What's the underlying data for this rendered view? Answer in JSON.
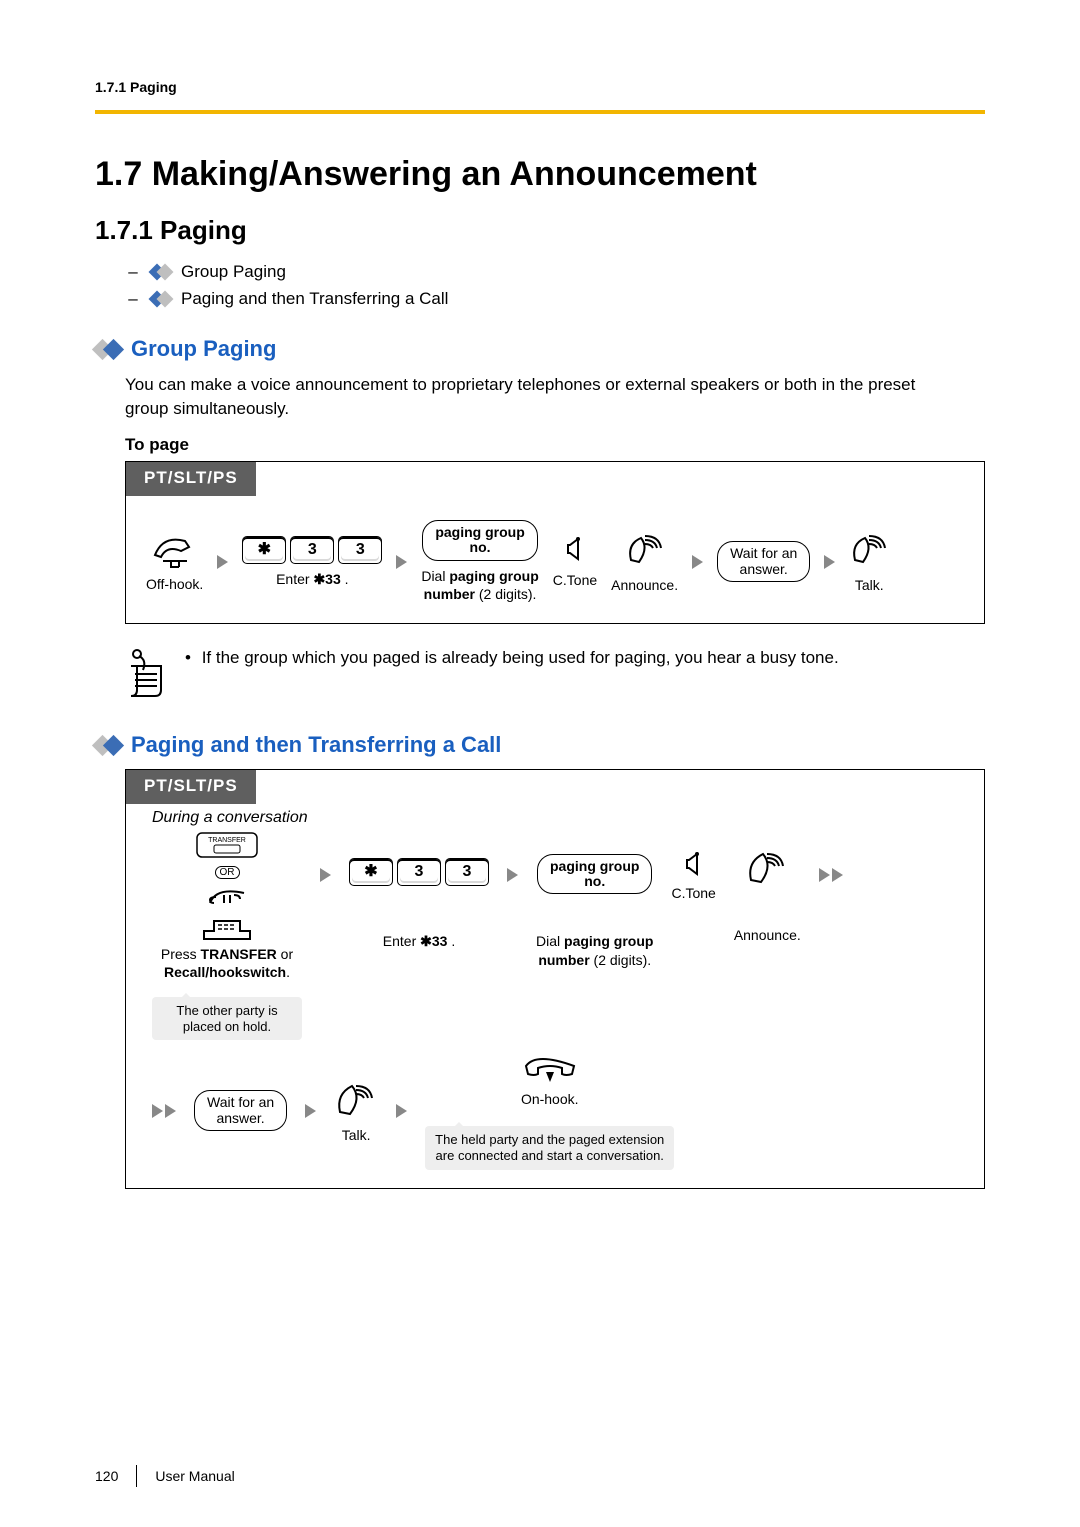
{
  "header": {
    "breadcrumb": "1.7.1 Paging"
  },
  "h1": "1.7  Making/Answering an Announcement",
  "h2": "1.7.1  Paging",
  "toc": {
    "item1": "Group Paging",
    "item2": "Paging and then Transferring a Call"
  },
  "group_paging": {
    "title": "Group Paging",
    "desc": "You can make a voice announcement to proprietary telephones or external speakers or both in the preset group simultaneously.",
    "to_page": "To page",
    "tab": "PT/SLT/PS",
    "steps": {
      "offhook": "Off-hook.",
      "star": "✱",
      "k3a": "3",
      "k3b": "3",
      "enter33_pre": "Enter ",
      "enter33_code": "✱33",
      "enter33_post": ".",
      "pg_box_l1": "paging group",
      "pg_box_l2": "no.",
      "dial_l1": "Dial paging group",
      "dial_l2": "number (2 digits).",
      "ctone": "C.Tone",
      "announce": "Announce.",
      "wait": "Wait for an\nanswer.",
      "talk": "Talk."
    },
    "note": "If the group which you paged is already being used for paging, you hear a busy tone."
  },
  "transfer": {
    "title": "Paging and then Transferring a Call",
    "tab": "PT/SLT/PS",
    "during": "During a conversation",
    "transfer_key": "TRANSFER",
    "or": "OR",
    "press_l1": "Press TRANSFER or",
    "press_l2": "Recall/hookswitch.",
    "hold_note": "The other party is placed on hold.",
    "star": "✱",
    "k3a": "3",
    "k3b": "3",
    "enter33_pre": "Enter ",
    "enter33_code": "✱33",
    "enter33_post": ".",
    "pg_box_l1": "paging group",
    "pg_box_l2": "no.",
    "dial_l1": "Dial paging group",
    "dial_l2": "number (2 digits).",
    "ctone": "C.Tone",
    "announce": "Announce.",
    "wait": "Wait for an\nanswer.",
    "talk": "Talk.",
    "onhook": "On-hook.",
    "onhook_note_l1": "The held party and the paged extension",
    "onhook_note_l2": "are connected and start a conversation."
  },
  "footer": {
    "page": "120",
    "label": "User Manual"
  }
}
